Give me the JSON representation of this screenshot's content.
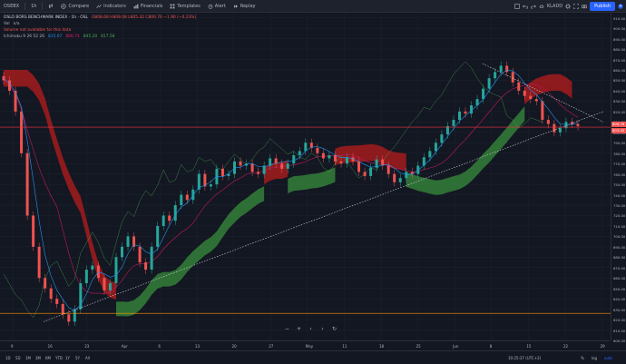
{
  "toolbar": {
    "symbol": "OSEBX",
    "interval": "1h",
    "compare": "Compare",
    "indicators": "Indicators",
    "financials": "Financials",
    "templates": "Templates",
    "alert": "Alert",
    "replay": "Replay",
    "layout_name": "KLADD",
    "publish": "Publish"
  },
  "legend": {
    "title": "OSLO BORS BENCHMARK INDEX · 1h · OSL",
    "ohlc": "O808.68 H809.08 L805.42 C806.76 −1.90 (−0.23%)",
    "vol_label": "Vol",
    "vol_value": "n/a",
    "volume_warning": "Volume not available for this data",
    "ichimoku_label": "Ichimoku 9 26 52 26",
    "ichimoku_v1": "815.07",
    "ichimoku_v2": "806.74",
    "ichimoku_v3": "845.20",
    "ichimoku_v4": "817.58"
  },
  "price_axis": {
    "ticks": [
      "910.00",
      "900.00",
      "890.00",
      "880.00",
      "870.00",
      "860.00",
      "850.00",
      "840.00",
      "830.00",
      "820.00",
      "810.00",
      "800.00",
      "790.00",
      "780.00",
      "770.00",
      "760.00",
      "750.00",
      "740.00",
      "730.00",
      "720.00",
      "710.00",
      "700.00",
      "690.00",
      "680.00",
      "670.00",
      "660.00",
      "650.00",
      "640.00",
      "630.00",
      "620.00",
      "610.00",
      "600.00"
    ],
    "last_price_tag": "806.76",
    "cloud_tag": "803.45"
  },
  "time_axis": {
    "ticks": [
      "9",
      "16",
      "23",
      "Apr",
      "6",
      "13",
      "20",
      "27",
      "May",
      "11",
      "18",
      "25",
      "Jun",
      "8",
      "15",
      "22",
      "29"
    ]
  },
  "bottom_bar": {
    "ranges": [
      "1D",
      "5D",
      "1M",
      "3M",
      "6M",
      "YTD",
      "1Y",
      "5Y",
      "All"
    ],
    "clock": "10:25:37 (UTC+2)",
    "pct": "%",
    "log": "log",
    "auto": "auto"
  },
  "colors": {
    "background": "#131722",
    "bull": "#26a69a",
    "bear": "#ef5350",
    "cloud_green": "#388e3c",
    "cloud_red": "#b71c1c",
    "conversion": "#2196f3",
    "base": "#880e4f",
    "lagging": "#4caf50",
    "hline_red": "#f23645",
    "hline_orange": "#ff9800",
    "accent": "#2962ff"
  },
  "chart_data": {
    "type": "candlestick",
    "ylim": [
      600,
      915
    ],
    "horizontal_lines": [
      805,
      626
    ],
    "close_series": [
      850,
      840,
      820,
      780,
      720,
      690,
      660,
      650,
      640,
      635,
      625,
      618,
      630,
      655,
      668,
      672,
      660,
      648,
      655,
      680,
      690,
      700,
      690,
      675,
      668,
      690,
      710,
      720,
      715,
      730,
      740,
      735,
      745,
      760,
      748,
      750,
      765,
      758,
      760,
      772,
      768,
      770,
      762,
      760,
      768,
      775,
      770,
      765,
      770,
      778,
      782,
      790,
      785,
      780,
      775,
      778,
      772,
      770,
      776,
      772,
      762,
      758,
      766,
      774,
      768,
      760,
      752,
      756,
      762,
      760,
      768,
      776,
      782,
      790,
      798,
      806,
      812,
      820,
      818,
      826,
      832,
      842,
      852,
      858,
      864,
      858,
      848,
      840,
      835,
      832,
      830,
      812,
      808,
      800,
      804,
      810,
      808,
      806
    ],
    "cloud_segments": [
      {
        "color": "red",
        "x_from": 0,
        "x_to": 19
      },
      {
        "color": "green",
        "x_from": 19,
        "x_to": 44
      },
      {
        "color": "red",
        "x_from": 44,
        "x_to": 48
      },
      {
        "color": "green",
        "x_from": 48,
        "x_to": 56
      },
      {
        "color": "red",
        "x_from": 56,
        "x_to": 68
      },
      {
        "color": "green",
        "x_from": 68,
        "x_to": 88
      },
      {
        "color": "red",
        "x_from": 88,
        "x_to": 96
      }
    ]
  }
}
